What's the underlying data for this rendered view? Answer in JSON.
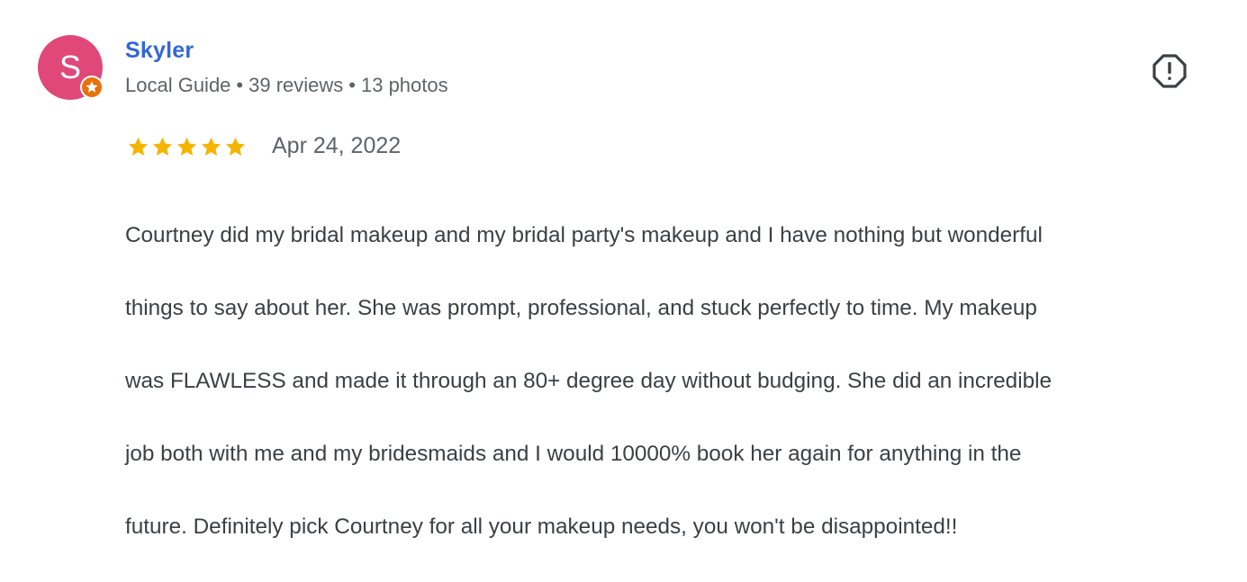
{
  "reviewer": {
    "name": "Skyler",
    "avatar_initial": "S",
    "avatar_color": "#e0487a",
    "badge_icon": "local-guide-star-icon",
    "meta": {
      "guide_label": "Local Guide",
      "reviews": "39 reviews",
      "photos": "13 photos",
      "separator": "•"
    }
  },
  "review": {
    "rating": 5,
    "rating_max": 5,
    "star_color": "#f4b400",
    "date": "Apr 24, 2022",
    "text_lines": [
      "Courtney did my bridal makeup and my bridal party's makeup and I have nothing but wonderful",
      "things to say about her. She was prompt, professional, and stuck perfectly to time. My makeup",
      "was FLAWLESS and made it through an 80+ degree day without budging. She did an incredible",
      "job both with me and my bridesmaids and I would 10000% book her again for anything in the",
      "future. Definitely pick Courtney for all your makeup needs, you won't be disappointed!!"
    ]
  },
  "actions": {
    "report_icon": "report-flag-icon"
  }
}
